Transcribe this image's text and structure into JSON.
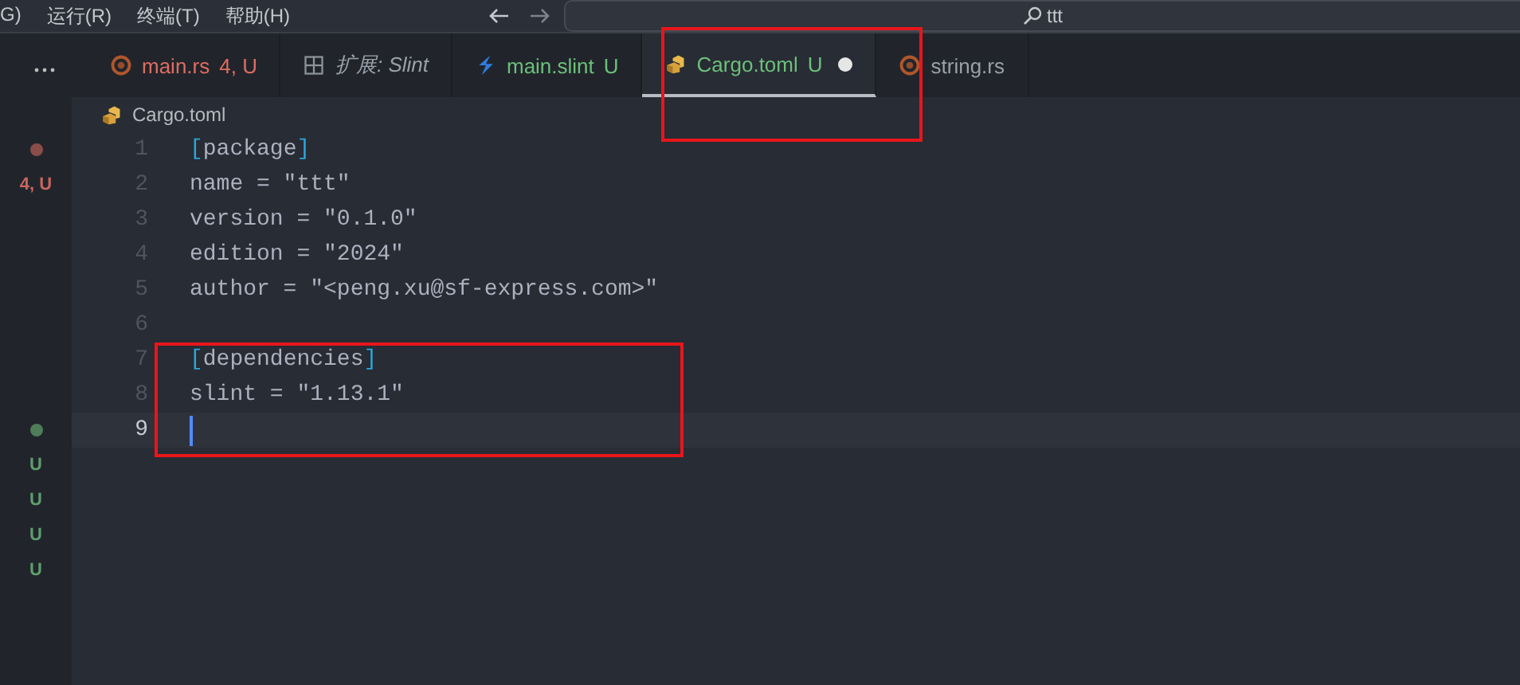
{
  "menu": [
    "G)",
    "运行(R)",
    "终端(T)",
    "帮助(H)"
  ],
  "search": {
    "value": "ttt"
  },
  "tabs": [
    {
      "label": "main.rs",
      "status": "4, U",
      "kind": "rust",
      "color": "#e06c62",
      "preview": false,
      "dirty": false,
      "selected": false
    },
    {
      "label": "扩展: Slint",
      "kind": "preview",
      "color": "#9aa0aa",
      "preview": true,
      "dirty": false,
      "selected": false
    },
    {
      "label": "main.slint",
      "status": "U",
      "kind": "slint",
      "color": "#6cc07a",
      "preview": false,
      "dirty": false,
      "selected": false
    },
    {
      "label": "Cargo.toml",
      "status": "U",
      "kind": "cargo",
      "color": "#6cc07a",
      "preview": false,
      "dirty": true,
      "selected": true
    },
    {
      "label": "string.rs",
      "kind": "rust",
      "color": "#9aa0aa",
      "preview": false,
      "dirty": false,
      "selected": false
    }
  ],
  "breadcrumb": {
    "label": "Cargo.toml"
  },
  "gutter": [
    {
      "kind": "dot",
      "color": "#8a4d48"
    },
    {
      "kind": "text",
      "text": "4, U",
      "color": "#c9665e"
    },
    {
      "kind": "blank"
    },
    {
      "kind": "blank"
    },
    {
      "kind": "blank"
    },
    {
      "kind": "blank"
    },
    {
      "kind": "blank"
    },
    {
      "kind": "blank"
    },
    {
      "kind": "dot",
      "color": "#4f7d59"
    },
    {
      "kind": "text",
      "text": "U",
      "color": "#5e9e6e"
    },
    {
      "kind": "text",
      "text": "U",
      "color": "#5e9e6e"
    },
    {
      "kind": "text",
      "text": "U",
      "color": "#5e9e6e"
    },
    {
      "kind": "text",
      "text": "U",
      "color": "#5e9e6e"
    }
  ],
  "lines": [
    {
      "number": "1",
      "current": false,
      "tokens": [
        {
          "text": "[",
          "kind": "bracket"
        },
        {
          "text": "package",
          "kind": "plain"
        },
        {
          "text": "]",
          "kind": "bracket"
        }
      ]
    },
    {
      "number": "2",
      "current": false,
      "tokens": [
        {
          "text": "name = \"ttt\"",
          "kind": "plain"
        }
      ]
    },
    {
      "number": "3",
      "current": false,
      "tokens": [
        {
          "text": "version = \"0.1.0\"",
          "kind": "plain"
        }
      ]
    },
    {
      "number": "4",
      "current": false,
      "tokens": [
        {
          "text": "edition = \"2024\"",
          "kind": "plain"
        }
      ]
    },
    {
      "number": "5",
      "current": false,
      "tokens": [
        {
          "text": "author = \"<peng.xu@sf-express.com>\"",
          "kind": "plain"
        }
      ]
    },
    {
      "number": "6",
      "current": false
    },
    {
      "number": "7",
      "current": false,
      "tokens": [
        {
          "text": "[",
          "kind": "bracket"
        },
        {
          "text": "dependencies",
          "kind": "plain"
        },
        {
          "text": "]",
          "kind": "bracket"
        }
      ]
    },
    {
      "number": "8",
      "current": false,
      "tokens": [
        {
          "text": "slint = \"1.13.1\"",
          "kind": "plain"
        }
      ]
    },
    {
      "number": "9",
      "current": true
    }
  ]
}
